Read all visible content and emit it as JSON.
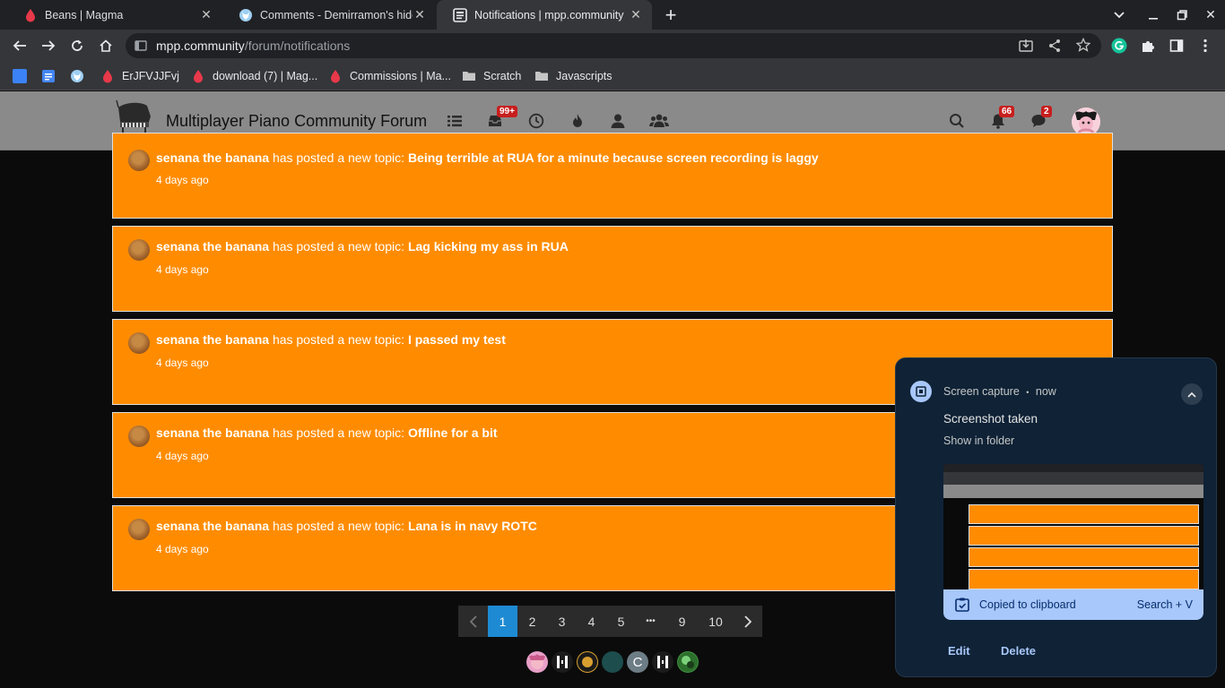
{
  "browser": {
    "tabs": [
      {
        "title": "Beans | Magma",
        "active": false
      },
      {
        "title": "Comments - Demirramon's hide(",
        "active": false
      },
      {
        "title": "Notifications | mpp.community",
        "active": true
      }
    ],
    "url": {
      "domain": "mpp.community",
      "path": "/forum/notifications"
    },
    "bookmarks": [
      {
        "label": "",
        "icon": "app-icon"
      },
      {
        "label": "",
        "icon": "docs-icon"
      },
      {
        "label": "",
        "icon": "wolf-icon"
      },
      {
        "label": "ErJFVJJFvj",
        "icon": "magma-icon"
      },
      {
        "label": "download (7) | Mag...",
        "icon": "magma-icon"
      },
      {
        "label": "Commissions | Ma...",
        "icon": "magma-icon"
      },
      {
        "label": "Scratch",
        "icon": "folder-icon"
      },
      {
        "label": "Javascripts",
        "icon": "folder-icon"
      }
    ]
  },
  "forum": {
    "title": "Multiplayer Piano Community Forum",
    "inbox_badge": "99+",
    "notifications_badge": "66",
    "chats_badge": "2"
  },
  "notifications": [
    {
      "user": "senana the banana",
      "action": "has posted a new topic:",
      "topic": "Being terrible at RUA for a minute because screen recording is laggy",
      "time": "4 days ago"
    },
    {
      "user": "senana the banana",
      "action": "has posted a new topic:",
      "topic": "Lag kicking my ass in RUA",
      "time": "4 days ago"
    },
    {
      "user": "senana the banana",
      "action": "has posted a new topic:",
      "topic": "I passed my test",
      "time": "4 days ago"
    },
    {
      "user": "senana the banana",
      "action": "has posted a new topic:",
      "topic": "Offline for a bit",
      "time": "4 days ago"
    },
    {
      "user": "senana the banana",
      "action": "has posted a new topic:",
      "topic": "Lana is in navy ROTC",
      "time": "4 days ago"
    }
  ],
  "pagination": {
    "pages": [
      "1",
      "2",
      "3",
      "4",
      "5",
      "•••",
      "9",
      "10"
    ],
    "current": "1"
  },
  "online_users": [
    {
      "initial": "",
      "color": "#e8a0c8"
    },
    {
      "initial": "",
      "color": "#1b1b1b"
    },
    {
      "initial": "",
      "color": "#d9a030"
    },
    {
      "initial": "",
      "color": "#1d4d4d"
    },
    {
      "initial": "C",
      "color": "#6d7d86"
    },
    {
      "initial": "",
      "color": "#1b1b1b"
    },
    {
      "initial": "",
      "color": "#3f8f3f"
    }
  ],
  "toast": {
    "source": "Screen capture",
    "separator": "•",
    "when": "now",
    "heading": "Screenshot taken",
    "subtext": "Show in folder",
    "clipboard": "Copied to clipboard",
    "shortcut": "Search + V",
    "edit": "Edit",
    "delete": "Delete"
  }
}
